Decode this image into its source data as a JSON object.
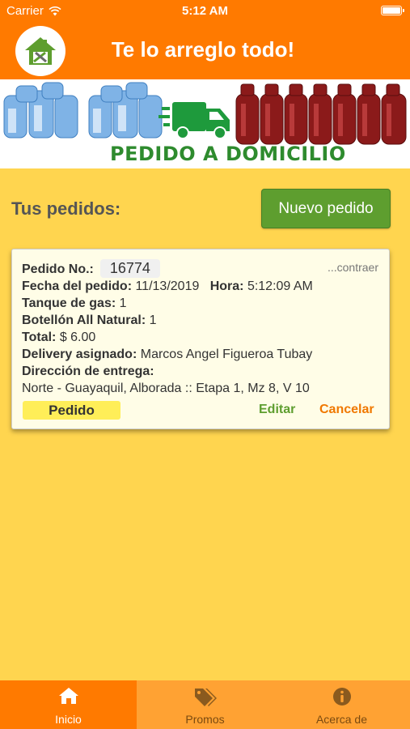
{
  "status_bar": {
    "carrier": "Carrier",
    "time": "5:12 AM"
  },
  "header": {
    "title": "Te lo arreglo todo!"
  },
  "banner": {
    "text": "PEDIDO A DOMICILIO"
  },
  "orders_section": {
    "title": "Tus pedidos:",
    "new_order_label": "Nuevo pedido"
  },
  "order": {
    "number_label": "Pedido No.:",
    "number": "16774",
    "collapse_label": "...contraer",
    "date_label": "Fecha del pedido:",
    "date": "11/13/2019",
    "time_label": "Hora:",
    "time": "5:12:09 AM",
    "gas_label": "Tanque de gas:",
    "gas_qty": "1",
    "water_label": "Botellón All Natural:",
    "water_qty": "1",
    "total_label": "Total:",
    "total": "$ 6.00",
    "delivery_label": "Delivery asignado:",
    "delivery": "Marcos Angel Figueroa Tubay",
    "address_label": "Dirección de entrega:",
    "address": "Norte - Guayaquil, Alborada :: Etapa 1, Mz 8, V 10",
    "status": "Pedido",
    "edit_label": "Editar",
    "cancel_label": "Cancelar"
  },
  "tabs": [
    {
      "label": "Inicio",
      "icon": "home-icon",
      "active": true
    },
    {
      "label": "Promos",
      "icon": "tags-icon",
      "active": false
    },
    {
      "label": "Acerca de",
      "icon": "info-icon",
      "active": false
    }
  ],
  "colors": {
    "primary": "#FF7A00",
    "background": "#FFD54F",
    "accent_green": "#5E9E2F",
    "tab_inactive": "#FFA233"
  }
}
